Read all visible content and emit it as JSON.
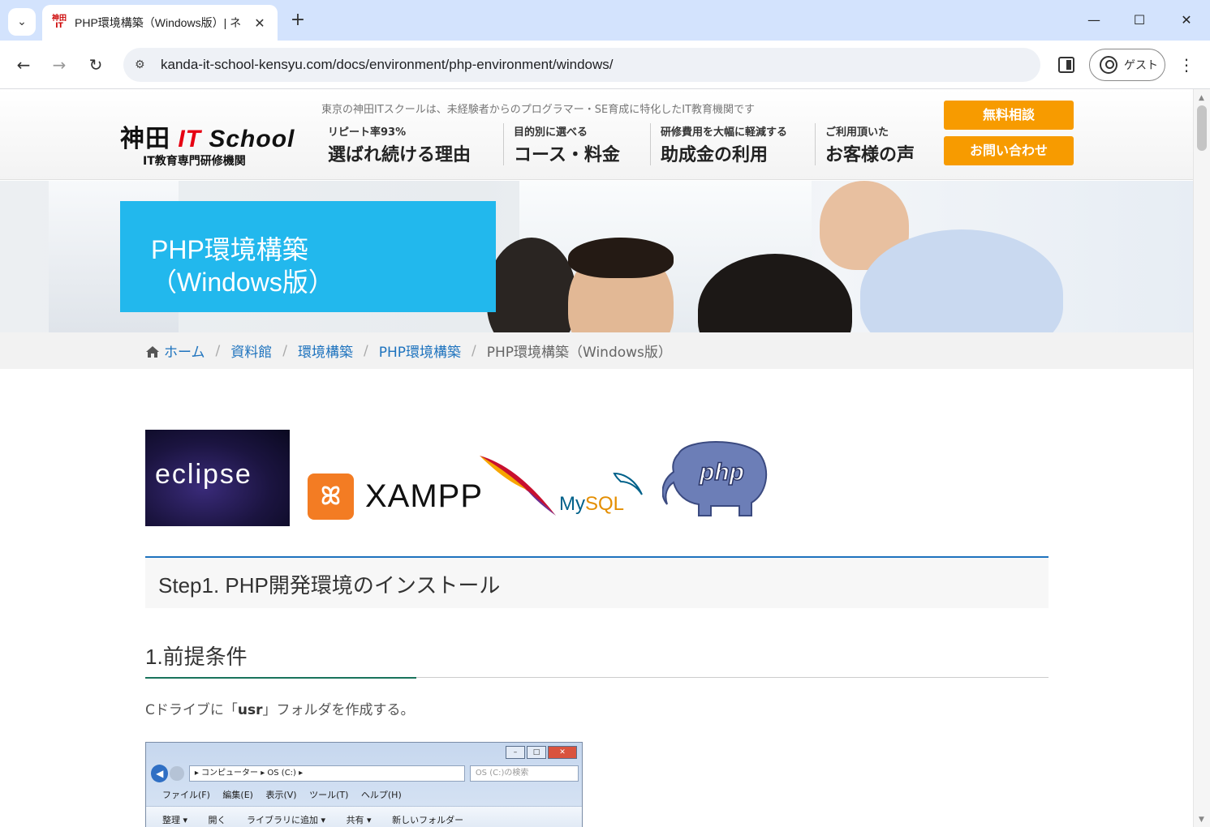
{
  "browser": {
    "tab_title": "PHP環境構築（Windows版）| ネ",
    "favicon_text": "神田IT",
    "url": "kanda-it-school-kensyu.com/docs/environment/php-environment/windows/",
    "profile_label": "ゲスト"
  },
  "header": {
    "logo_main_1": "神田",
    "logo_main_it": "IT",
    "logo_main_school": "School",
    "logo_sub": "IT教育専門研修機関",
    "tagline": "東京の神田ITスクールは、未経験者からのプログラマー・SE育成に特化したIT教育機関です",
    "nav": [
      {
        "small": "リピート率93%",
        "big": "選ばれ続ける理由"
      },
      {
        "small": "目的別に選べる",
        "big": "コース・料金"
      },
      {
        "small": "研修費用を大幅に軽減する",
        "big": "助成金の利用"
      },
      {
        "small": "ご利用頂いた",
        "big": "お客様の声"
      }
    ],
    "cta_consult": "無料相談",
    "cta_contact": "お問い合わせ"
  },
  "hero": {
    "title_line1": "PHP環境構築",
    "title_line2": "（Windows版）"
  },
  "breadcrumb": {
    "items": [
      "ホーム",
      "資料館",
      "環境構築",
      "PHP環境構築"
    ],
    "current": "PHP環境構築（Windows版）"
  },
  "logos": {
    "eclipse": "eclipse",
    "xampp_badge": "ꕤ",
    "xampp": "XAMPP",
    "mysql_my": "My",
    "mysql_sql": "SQL",
    "php": "php"
  },
  "content": {
    "step_heading": "Step1. PHP開発環境のインストール",
    "sub_heading": "1.前提条件",
    "paragraph_pre": "Cドライブに「",
    "paragraph_bold": "usr",
    "paragraph_post": "」フォルダを作成する。"
  },
  "explorer": {
    "address": "▸ コンピューター ▸ OS (C:) ▸",
    "search_placeholder": "OS (C:)の検索",
    "menu": [
      "ファイル(F)",
      "編集(E)",
      "表示(V)",
      "ツール(T)",
      "ヘルプ(H)"
    ],
    "commands": [
      "整理 ▾",
      "開く",
      "ライブラリに追加 ▾",
      "共有 ▾",
      "新しいフォルダー"
    ]
  }
}
